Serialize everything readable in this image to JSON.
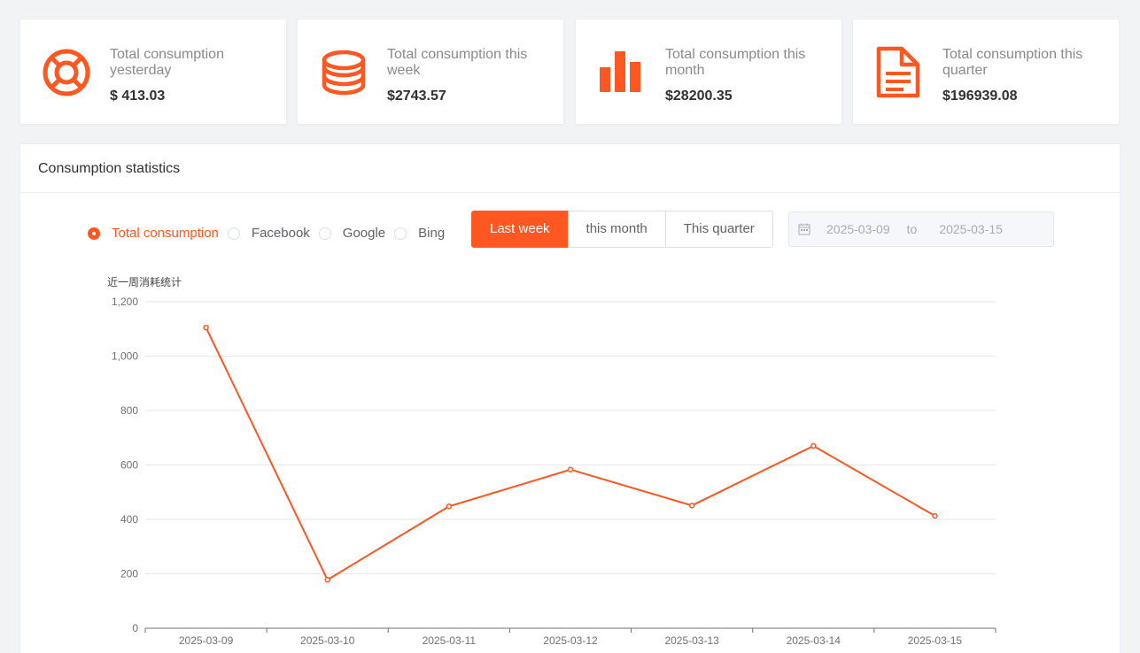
{
  "cards": [
    {
      "label": "Total consumption yesterday",
      "value": "$ 413.03",
      "icon": "lifebuoy-icon"
    },
    {
      "label": "Total consumption this week",
      "value": "$2743.57",
      "icon": "coin-stack-icon"
    },
    {
      "label": "Total consumption this month",
      "value": "$28200.35",
      "icon": "bar-chart-icon"
    },
    {
      "label": "Total consumption this quarter",
      "value": "$196939.08",
      "icon": "document-icon"
    }
  ],
  "panel": {
    "title": "Consumption statistics",
    "radios": [
      {
        "label": "Total consumption",
        "selected": true
      },
      {
        "label": "Facebook",
        "selected": false
      },
      {
        "label": "Google",
        "selected": false
      },
      {
        "label": "Bing",
        "selected": false
      }
    ],
    "periods": [
      {
        "label": "Last week",
        "active": true
      },
      {
        "label": "this month",
        "active": false
      },
      {
        "label": "This quarter",
        "active": false
      }
    ],
    "date_range": {
      "start": "2025-03-09",
      "separator": "to",
      "end": "2025-03-15"
    }
  },
  "colors": {
    "accent": "#ff5722",
    "grid": "#e6e6e6",
    "axis_text": "#6e7079"
  },
  "chart_data": {
    "type": "line",
    "title": "近一周消耗统计",
    "categories": [
      "2025-03-09",
      "2025-03-10",
      "2025-03-11",
      "2025-03-12",
      "2025-03-13",
      "2025-03-14",
      "2025-03-15"
    ],
    "series": [
      {
        "values": [
          1105,
          178,
          448,
          583,
          451,
          670,
          413.03
        ]
      }
    ],
    "ylim": [
      0,
      1200
    ],
    "yticks": [
      0,
      200,
      400,
      600,
      800,
      1000,
      1200
    ],
    "grid": true
  }
}
